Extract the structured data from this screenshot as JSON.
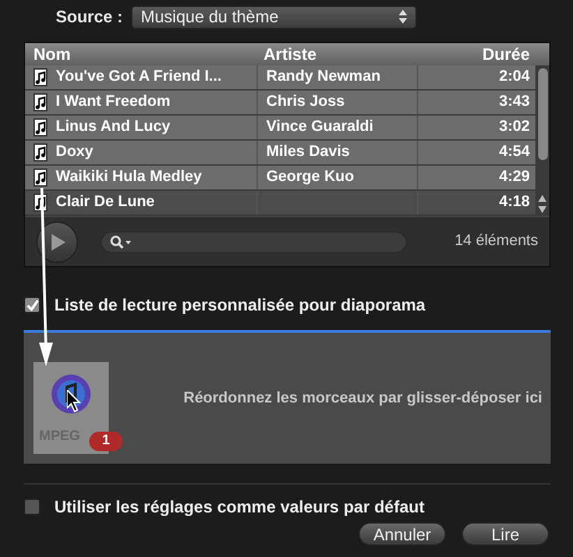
{
  "source": {
    "label": "Source :",
    "value": "Musique du thème"
  },
  "table": {
    "columns": [
      "Nom",
      "Artiste",
      "Durée"
    ],
    "rows": [
      {
        "cells": [
          "You've Got A Friend I...",
          "Randy Newman",
          "2:04"
        ],
        "selected": true
      },
      {
        "cells": [
          "I Want Freedom",
          "Chris Joss",
          "3:43"
        ],
        "selected": true
      },
      {
        "cells": [
          "Linus And Lucy",
          "Vince Guaraldi",
          "3:02"
        ],
        "selected": true
      },
      {
        "cells": [
          "Doxy",
          "Miles Davis",
          "4:54"
        ],
        "selected": true
      },
      {
        "cells": [
          "Waikiki Hula Medley",
          "George Kuo",
          "4:29"
        ],
        "selected": true
      },
      {
        "cells": [
          "Clair De Lune",
          "",
          "4:18"
        ],
        "selected": false
      }
    ]
  },
  "item_count": "14 éléments",
  "playlist_option": {
    "label": "Liste de lecture personnalisée pour diaporama",
    "checked": true
  },
  "drop_zone": {
    "hint": "Réordonnez les morceaux par glisser-déposer ici"
  },
  "drag": {
    "file_label": "MPEG",
    "count": "1"
  },
  "defaults_option": {
    "label": "Utiliser les réglages comme valeurs par défaut",
    "checked": false
  },
  "buttons": [
    "Annuler",
    "Lire"
  ]
}
